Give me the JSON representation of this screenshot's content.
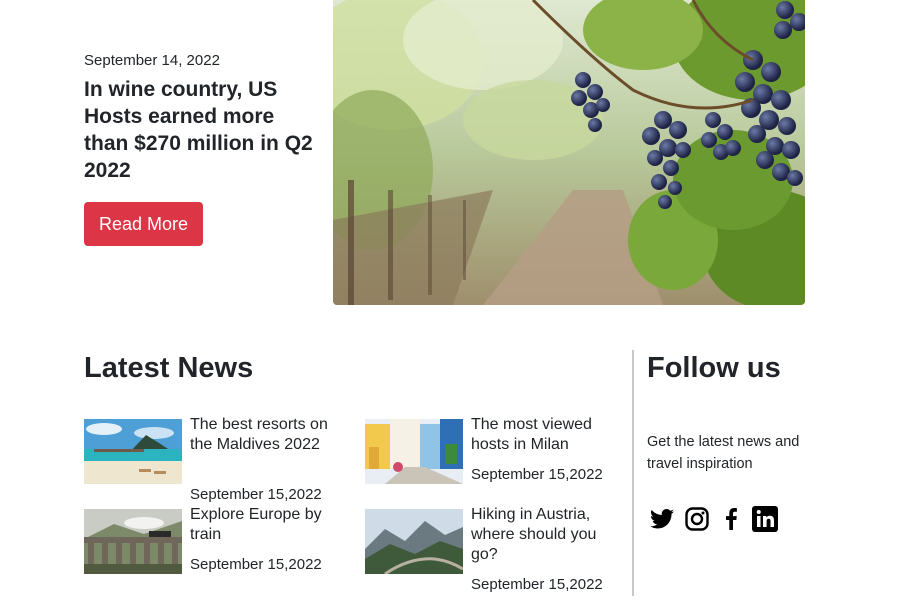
{
  "hero": {
    "date": "September 14, 2022",
    "title": "In wine country, US Hosts earned more than $270 million in Q2 2022",
    "button_label": "Read More",
    "image": "vineyard-grapes-photo",
    "button_color": "#dc3545"
  },
  "latest_news": {
    "title": "Latest News",
    "items": [
      {
        "headline": "The best resorts on the Maldives 2022",
        "date": "September 15,2022",
        "image": "maldives-beach-photo"
      },
      {
        "headline": "The most viewed hosts in Milan",
        "date": "September 15,2022",
        "image": "colorful-street-photo"
      },
      {
        "headline": "Explore Europe by train",
        "date": "September 15,2022",
        "image": "viaduct-train-photo"
      },
      {
        "headline": "Hiking in Austria, where should you go?",
        "date": "September 15,2022",
        "image": "mountain-valley-photo"
      }
    ]
  },
  "follow": {
    "title": "Follow us",
    "text": "Get the latest news and travel inspiration",
    "social": [
      "twitter-icon",
      "instagram-icon",
      "facebook-icon",
      "linkedin-icon"
    ]
  }
}
